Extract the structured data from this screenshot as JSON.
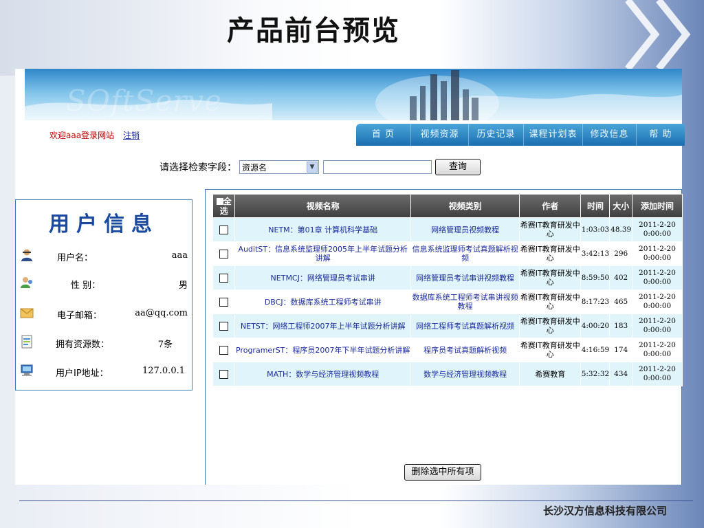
{
  "slide": {
    "title": "产品前台预览",
    "footer": "长沙汉方信息科技有限公司"
  },
  "banner": {
    "watermark": "SOftServe"
  },
  "header": {
    "welcome_text": "欢迎aaa登录网站",
    "logout_label": "注销"
  },
  "nav": {
    "items": [
      {
        "label": "首 页"
      },
      {
        "label": "视频资源"
      },
      {
        "label": "历史记录"
      },
      {
        "label": "课程计划表"
      },
      {
        "label": "修改信息"
      },
      {
        "label": "帮 助"
      }
    ]
  },
  "search": {
    "label": "请选择检索字段：",
    "field_selected": "资源名",
    "query_value": "",
    "button_label": "查询"
  },
  "user": {
    "title": "用户信息",
    "rows": [
      {
        "label": "用户名：",
        "value": "aaa",
        "icon": "user-icon"
      },
      {
        "label": "性 别：",
        "value": "男",
        "icon": "gender-icon"
      },
      {
        "label": "电子邮箱：",
        "value": "aa@qq.com",
        "icon": "email-icon"
      },
      {
        "label": "拥有资源数：",
        "value": "7条",
        "icon": "document-icon"
      },
      {
        "label": "用户IP地址：",
        "value": "127.0.0.1",
        "icon": "computer-icon"
      }
    ]
  },
  "table": {
    "headers": {
      "select_all": "全选",
      "name": "视频名称",
      "category": "视频类别",
      "author": "作者",
      "time": "时间",
      "size": "大小",
      "added": "添加时间"
    },
    "rows": [
      {
        "name": "NETM：第01章 计算机科学基础",
        "category": "网络管理员视频教程",
        "author": "希赛IT教育研发中心",
        "time": "1:03:03",
        "size": "48.39",
        "added": "2011-2-20 0:00:00"
      },
      {
        "name": "AuditST：信息系统监理师2005年上半年试题分析讲解",
        "category": "信息系统监理师考试真题解析视频",
        "author": "希赛IT教育研发中心",
        "time": "3:42:13",
        "size": "296",
        "added": "2011-2-20 0:00:00"
      },
      {
        "name": "NETMCJ：网络管理员考试串讲",
        "category": "网络管理员考试串讲视频教程",
        "author": "希赛IT教育研发中心",
        "time": "8:59:50",
        "size": "402",
        "added": "2011-2-20 0:00:00"
      },
      {
        "name": "DBCJ：数据库系统工程师考试串讲",
        "category": "数据库系统工程师考试串讲视频教程",
        "author": "希赛IT教育研发中心",
        "time": "8:17:23",
        "size": "465",
        "added": "2011-2-20 0:00:00"
      },
      {
        "name": "NETST：网络工程师2007年上半年试题分析讲解",
        "category": "网络工程师考试真题解析视频",
        "author": "希赛IT教育研发中心",
        "time": "4:00:20",
        "size": "183",
        "added": "2011-2-20 0:00:00"
      },
      {
        "name": "ProgramerST：程序员2007年下半年试题分析讲解",
        "category": "程序员考试真题解析视频",
        "author": "希赛IT教育研发中心",
        "time": "4:16:59",
        "size": "174",
        "added": "2011-2-20 0:00:00"
      },
      {
        "name": "MATH：数学与经济管理视频教程",
        "category": "数学与经济管理视频教程",
        "author": "希赛教育",
        "time": "5:32:32",
        "size": "434",
        "added": "2011-2-20 0:00:00"
      }
    ],
    "delete_label": "删除选中所有项"
  }
}
